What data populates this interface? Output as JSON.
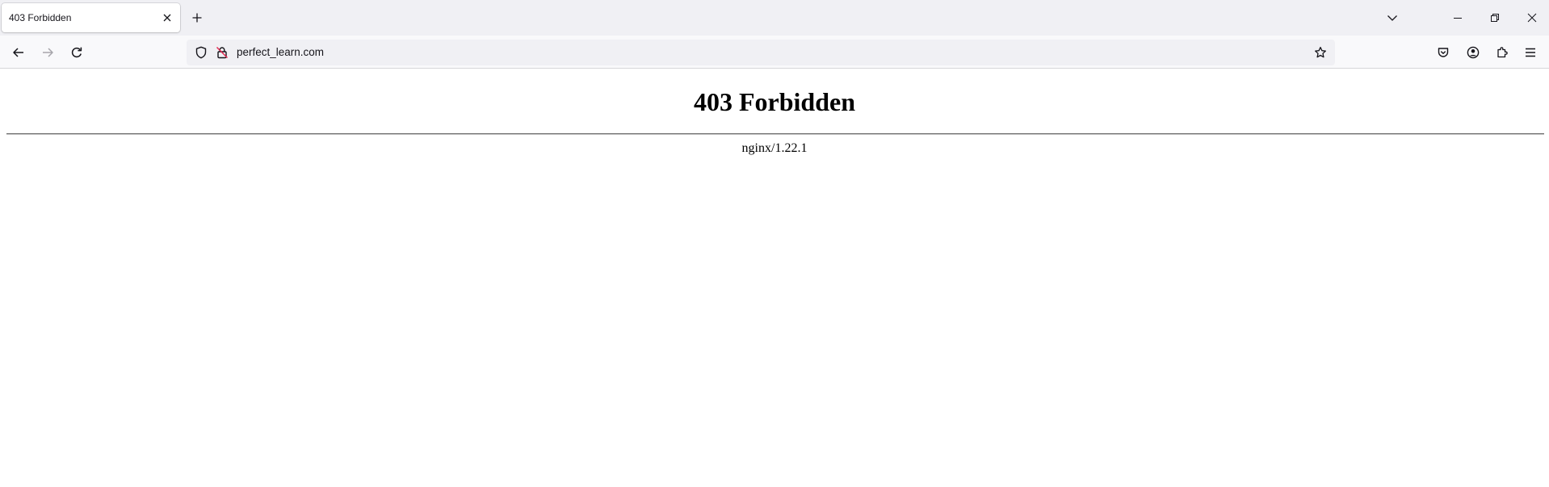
{
  "browser": {
    "tabs": [
      {
        "title": "403 Forbidden",
        "active": true
      }
    ],
    "url": "perfect_learn.com",
    "icons": {
      "tab_close": "close-icon",
      "new_tab": "plus-icon",
      "list_tabs": "chevron-down-icon",
      "back": "arrow-left-icon",
      "forward": "arrow-right-icon",
      "reload": "reload-icon",
      "tracking_protection": "shield-icon",
      "connection": "insecure-lock-icon",
      "bookmark": "star-icon",
      "pocket": "pocket-icon",
      "account": "account-icon",
      "extensions": "puzzle-icon",
      "menu": "hamburger-menu-icon",
      "minimize": "minimize-icon",
      "restore": "restore-icon",
      "close_window": "close-icon"
    },
    "colors": {
      "tabstrip_bg": "#f0f0f4",
      "navbar_bg": "#f9f9fb",
      "urlbar_bg": "#f0f0f4",
      "icon": "#15141a",
      "insecure_accent": "#e22850"
    }
  },
  "page": {
    "heading": "403 Forbidden",
    "server": "nginx/1.22.1"
  }
}
